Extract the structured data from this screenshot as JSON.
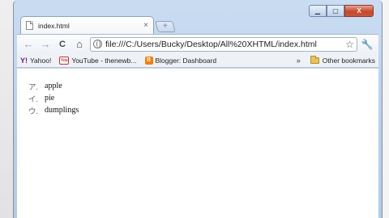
{
  "window": {
    "controls": {
      "minimize": "▁",
      "maximize": "▢",
      "close": "X"
    }
  },
  "tab": {
    "title": "index.html",
    "close": "×",
    "new_tab_icon": "+"
  },
  "toolbar": {
    "back": "←",
    "forward": "→",
    "reload": "C",
    "home": "⌂",
    "url": "file:///C:/Users/Bucky/Desktop/All%20XHTML/index.html",
    "star": "☆",
    "wrench": "🔧"
  },
  "bookmarks": {
    "items": [
      {
        "label": "Yahoo!",
        "icon": "yahoo-icon",
        "mark": "Y!"
      },
      {
        "label": "YouTube - thenewb...",
        "icon": "youtube-icon",
        "mark": "You"
      },
      {
        "label": "Blogger: Dashboard",
        "icon": "blogger-icon",
        "mark": "B"
      }
    ],
    "overflow": "»",
    "other": "Other bookmarks"
  },
  "content": {
    "list": [
      {
        "marker": "ア.",
        "text": "apple"
      },
      {
        "marker": "イ.",
        "text": "pie"
      },
      {
        "marker": "ウ.",
        "text": "dumplings"
      }
    ]
  }
}
